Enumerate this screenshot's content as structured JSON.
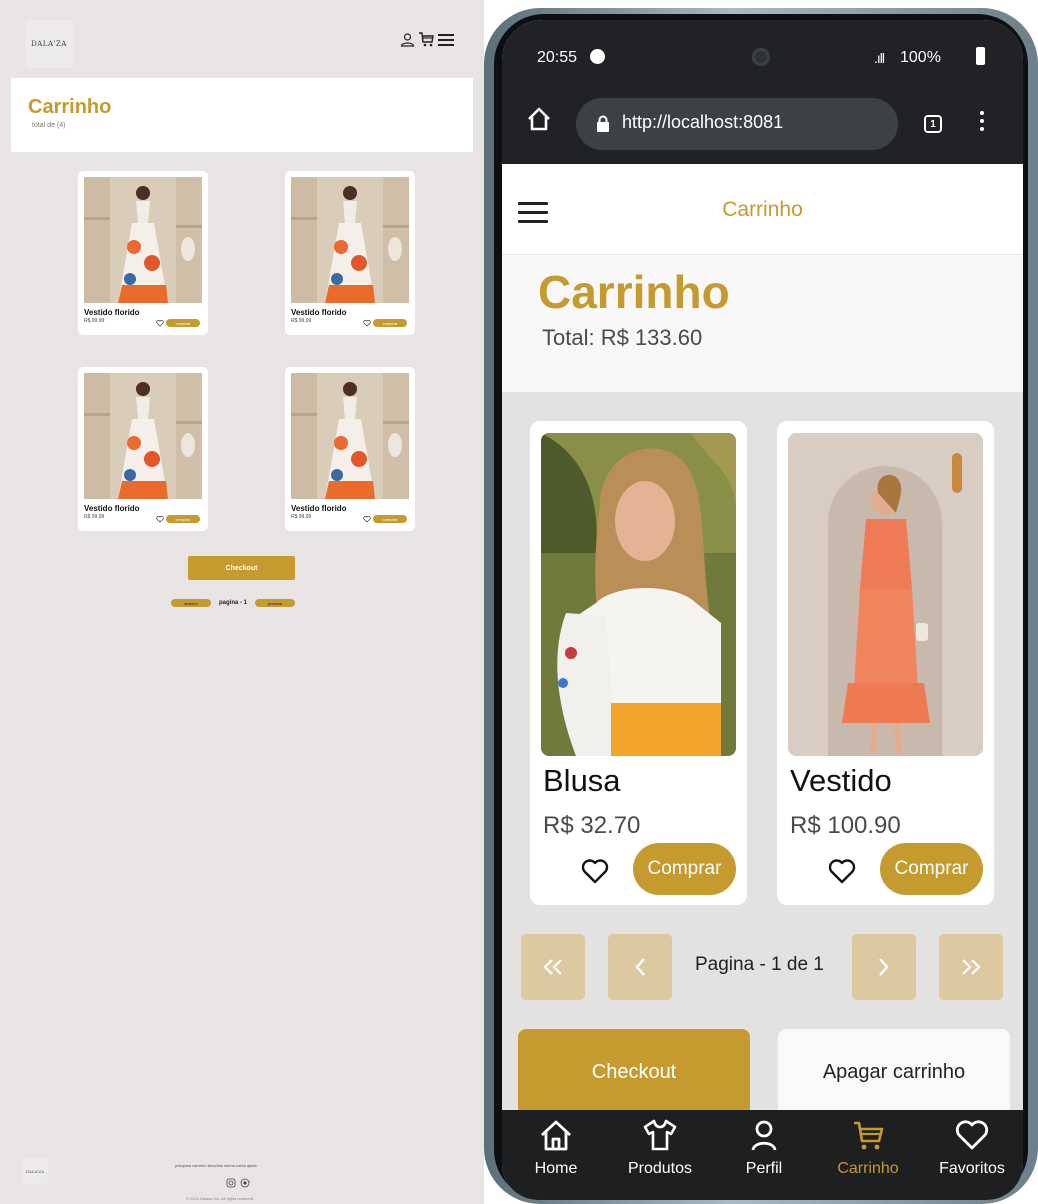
{
  "desktop": {
    "logo_text": "DALA'ZA",
    "title": "Carrinho",
    "subtitle": "total de (4)",
    "products": [
      {
        "name": "Vestido florido",
        "price": "R$ 99,99",
        "buy_label": "comprar"
      },
      {
        "name": "Vestido florido",
        "price": "R$ 99,99",
        "buy_label": "comprar"
      },
      {
        "name": "Vestido florido",
        "price": "R$ 99,99",
        "buy_label": "comprar"
      },
      {
        "name": "Vestido florido",
        "price": "R$ 99,99",
        "buy_label": "comprar"
      }
    ],
    "checkout_label": "Checkout",
    "pagination": {
      "prev_label": "anterior",
      "page_text": "pagina - 1",
      "next_label": "proxima"
    },
    "footer": {
      "links": "pesquisa  carrinho  favoritos  minha conta  ajuda",
      "copyright": "© 2024 Dalaza Inc. All rights reserved."
    }
  },
  "mobile": {
    "status_bar": {
      "time": "20:55",
      "signal": ".ıll",
      "battery": "100%"
    },
    "browser": {
      "url": "http://localhost:8081",
      "tab_count": "1"
    },
    "app_bar_title": "Carrinho",
    "cart_title": "Carrinho",
    "cart_total": "Total: R$ 133.60",
    "products": [
      {
        "name": "Blusa",
        "price": "R$ 32.70",
        "buy_label": "Comprar"
      },
      {
        "name": "Vestido",
        "price": "R$ 100.90",
        "buy_label": "Comprar"
      }
    ],
    "pagination_text": "Pagina - 1 de 1",
    "checkout_label": "Checkout",
    "clear_cart_label": "Apagar carrinho",
    "tabs": [
      {
        "label": "Home",
        "icon": "home-icon"
      },
      {
        "label": "Produtos",
        "icon": "shirt-icon"
      },
      {
        "label": "Perfil",
        "icon": "user-icon"
      },
      {
        "label": "Carrinho",
        "icon": "cart-icon",
        "active": true
      },
      {
        "label": "Favoritos",
        "icon": "heart-icon"
      }
    ]
  },
  "colors": {
    "accent": "#c59a2e",
    "accent_light": "#dcc9a0",
    "desktop_bg": "#e7e4e3",
    "tab_bar": "#1d1f21"
  }
}
